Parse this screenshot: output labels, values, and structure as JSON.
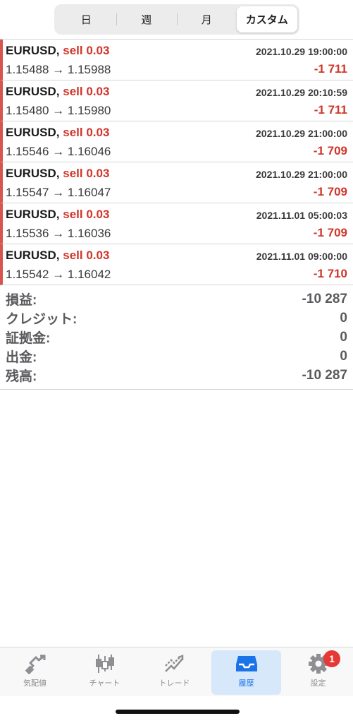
{
  "segments": [
    {
      "label": "日",
      "active": false
    },
    {
      "label": "週",
      "active": false
    },
    {
      "label": "月",
      "active": false
    },
    {
      "label": "カスタム",
      "active": true
    }
  ],
  "trades": [
    {
      "symbol": "EURUSD,",
      "side": "sell 0.03",
      "time": "2021.10.29 19:00:00",
      "prices": "1.15488 → 1.15988",
      "profit": "-1 711"
    },
    {
      "symbol": "EURUSD,",
      "side": "sell 0.03",
      "time": "2021.10.29 20:10:59",
      "prices": "1.15480 → 1.15980",
      "profit": "-1 711"
    },
    {
      "symbol": "EURUSD,",
      "side": "sell 0.03",
      "time": "2021.10.29 21:00:00",
      "prices": "1.15546 → 1.16046",
      "profit": "-1 709"
    },
    {
      "symbol": "EURUSD,",
      "side": "sell 0.03",
      "time": "2021.10.29 21:00:00",
      "prices": "1.15547 → 1.16047",
      "profit": "-1 709"
    },
    {
      "symbol": "EURUSD,",
      "side": "sell 0.03",
      "time": "2021.11.01 05:00:03",
      "prices": "1.15536 → 1.16036",
      "profit": "-1 709"
    },
    {
      "symbol": "EURUSD,",
      "side": "sell 0.03",
      "time": "2021.11.01 09:00:00",
      "prices": "1.15542 → 1.16042",
      "profit": "-1 710"
    }
  ],
  "summary": [
    {
      "label": "損益:",
      "value": "-10 287"
    },
    {
      "label": "クレジット:",
      "value": "0"
    },
    {
      "label": "証拠金:",
      "value": "0"
    },
    {
      "label": "出金:",
      "value": "0"
    },
    {
      "label": "残高:",
      "value": "-10 287"
    }
  ],
  "tabs": [
    {
      "label": "気配値",
      "icon": "quotes-icon",
      "active": false
    },
    {
      "label": "チャート",
      "icon": "candlestick-chart-icon",
      "active": false
    },
    {
      "label": "トレード",
      "icon": "trade-icon",
      "active": false
    },
    {
      "label": "履歴",
      "icon": "history-inbox-icon",
      "active": true
    },
    {
      "label": "設定",
      "icon": "gear-icon",
      "active": false,
      "badge": "1"
    }
  ],
  "colors": {
    "loss": "#d0362b",
    "accent": "#1a73e8",
    "active_tab_bg": "#d8e8fb",
    "badge": "#e53935"
  }
}
